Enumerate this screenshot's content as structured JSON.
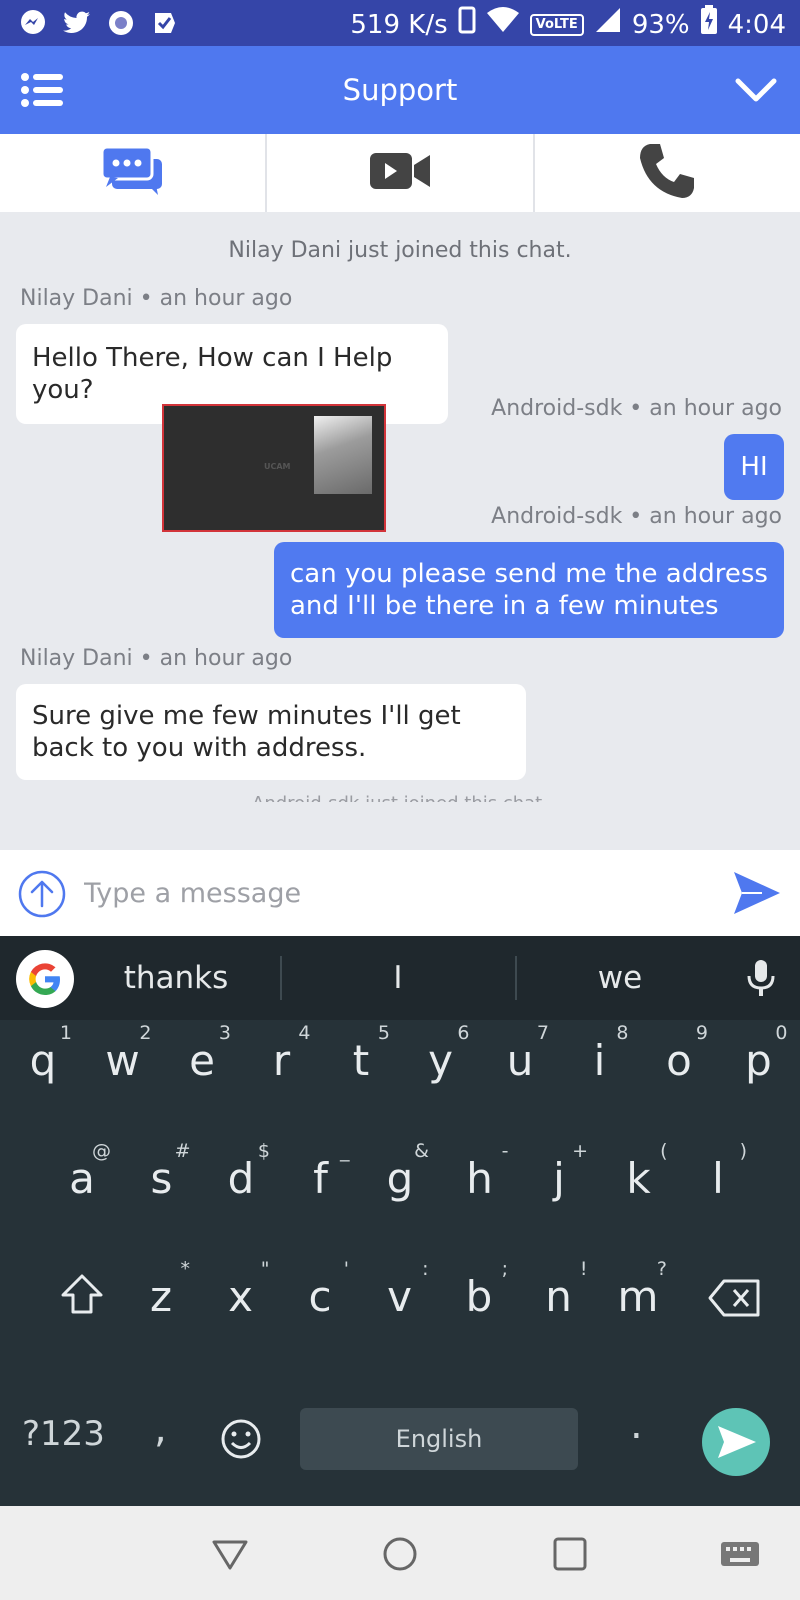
{
  "status_bar": {
    "net_speed": "519 K/s",
    "volte": "VoLTE",
    "battery": "93%",
    "time": "4:04"
  },
  "app_bar": {
    "title": "Support"
  },
  "tabs": [
    {
      "icon": "chat-bubbles-icon",
      "active": true
    },
    {
      "icon": "video-camera-icon",
      "active": false
    },
    {
      "icon": "phone-icon",
      "active": false
    }
  ],
  "chat": {
    "system_message": "Nilay Dani just joined this chat.",
    "messages": [
      {
        "sender": "Nilay Dani",
        "time": "an hour ago",
        "text": "Hello There, How can I Help you?",
        "direction": "in"
      },
      {
        "sender": "Android-sdk",
        "time": "an hour ago",
        "text": "HI",
        "direction": "out"
      },
      {
        "sender": "Android-sdk",
        "time": "an hour ago",
        "text": "can you please send me the address and I'll be there in a few minutes",
        "direction": "out"
      },
      {
        "sender": "Nilay Dani",
        "time": "an hour ago",
        "text": "Sure give me few minutes I'll get back to you with address.",
        "direction": "in"
      }
    ],
    "thumbnail_label": "UCAM",
    "faded_message": "Android-sdk just joined this chat."
  },
  "input": {
    "placeholder": "Type a message"
  },
  "keyboard": {
    "suggestions": [
      "thanks",
      "I",
      "we"
    ],
    "row1": [
      {
        "ch": "q",
        "hint": "1"
      },
      {
        "ch": "w",
        "hint": "2"
      },
      {
        "ch": "e",
        "hint": "3"
      },
      {
        "ch": "r",
        "hint": "4"
      },
      {
        "ch": "t",
        "hint": "5"
      },
      {
        "ch": "y",
        "hint": "6"
      },
      {
        "ch": "u",
        "hint": "7"
      },
      {
        "ch": "i",
        "hint": "8"
      },
      {
        "ch": "o",
        "hint": "9"
      },
      {
        "ch": "p",
        "hint": "0"
      }
    ],
    "row2": [
      {
        "ch": "a",
        "hint": "@"
      },
      {
        "ch": "s",
        "hint": "#"
      },
      {
        "ch": "d",
        "hint": "$"
      },
      {
        "ch": "f",
        "hint": "_"
      },
      {
        "ch": "g",
        "hint": "&"
      },
      {
        "ch": "h",
        "hint": "-"
      },
      {
        "ch": "j",
        "hint": "+"
      },
      {
        "ch": "k",
        "hint": "("
      },
      {
        "ch": "l",
        "hint": ")"
      }
    ],
    "row3": [
      {
        "ch": "z",
        "hint": "*"
      },
      {
        "ch": "x",
        "hint": "\""
      },
      {
        "ch": "c",
        "hint": "'"
      },
      {
        "ch": "v",
        "hint": ":"
      },
      {
        "ch": "b",
        "hint": ";"
      },
      {
        "ch": "n",
        "hint": "!"
      },
      {
        "ch": "m",
        "hint": "?"
      }
    ],
    "symbols_label": "?123",
    "comma": ",",
    "period": ".",
    "space_label": "English"
  },
  "colors": {
    "status_bar": "#3545a8",
    "app_bar": "#4f78ef",
    "outgoing_bubble": "#507af0",
    "keyboard_bg": "#263238",
    "enter_key": "#5ec4b6"
  }
}
